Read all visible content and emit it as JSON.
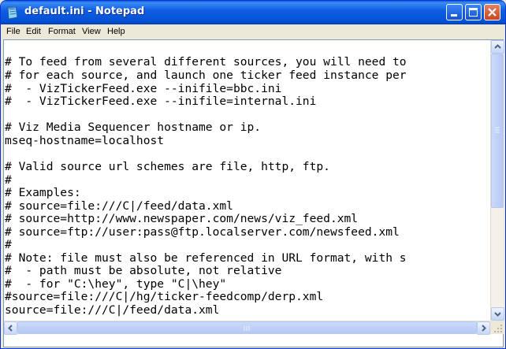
{
  "window": {
    "title": "default.ini - Notepad"
  },
  "menu": {
    "items": [
      "File",
      "Edit",
      "Format",
      "View",
      "Help"
    ]
  },
  "editor": {
    "lines": [
      "# To feed from several different sources, you will need to",
      "# for each source, and launch one ticker feed instance per",
      "#  - VizTickerFeed.exe --inifile=bbc.ini",
      "#  - VizTickerFeed.exe --inifile=internal.ini",
      "",
      "# Viz Media Sequencer hostname or ip.",
      "mseq-hostname=localhost",
      "",
      "# Valid source url schemes are file, http, ftp.",
      "#",
      "# Examples:",
      "# source=file:///C|/feed/data.xml",
      "# source=http://www.newspaper.com/news/viz_feed.xml",
      "# source=ftp://user:pass@ftp.localserver.com/newsfeed.xml",
      "#",
      "# Note: file must also be referenced in URL format, with s",
      "#  - path must be absolute, not relative",
      "#  - for \"C:\\hey\", type \"C|\\hey\"",
      "#source=file:///C|/hg/ticker-feedcomp/derp.xml",
      "source=file:///C|/feed/data.xml"
    ]
  },
  "icons": {
    "app": "notepad-icon",
    "minimize": "minimize-icon",
    "maximize": "maximize-icon",
    "close": "close-icon"
  },
  "colors": {
    "title_bar": "#0550d6",
    "close_button": "#c94520"
  }
}
